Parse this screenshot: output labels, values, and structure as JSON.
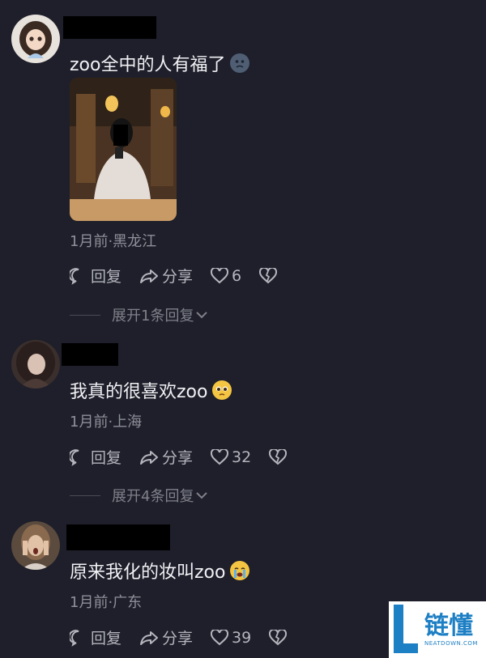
{
  "comments": [
    {
      "text": "zoo全中的人有福了",
      "meta": "1月前·黑龙江",
      "reply_label": "回复",
      "share_label": "分享",
      "likes": "6",
      "expand_label": "展开1条回复"
    },
    {
      "text": "我真的很喜欢zoo",
      "meta": "1月前·上海",
      "reply_label": "回复",
      "share_label": "分享",
      "likes": "32",
      "expand_label": "展开4条回复"
    },
    {
      "text": "原来我化的妆叫zoo",
      "meta": "1月前·广东",
      "reply_label": "回复",
      "share_label": "分享",
      "likes": "39"
    }
  ],
  "watermark": {
    "main": "链懂",
    "sub": "NEATDOWN.COM"
  },
  "colors": {
    "background": "#1e1f2a",
    "text": "#f1f1f5",
    "meta": "#8e8f99",
    "icon": "#b4b5bd"
  }
}
